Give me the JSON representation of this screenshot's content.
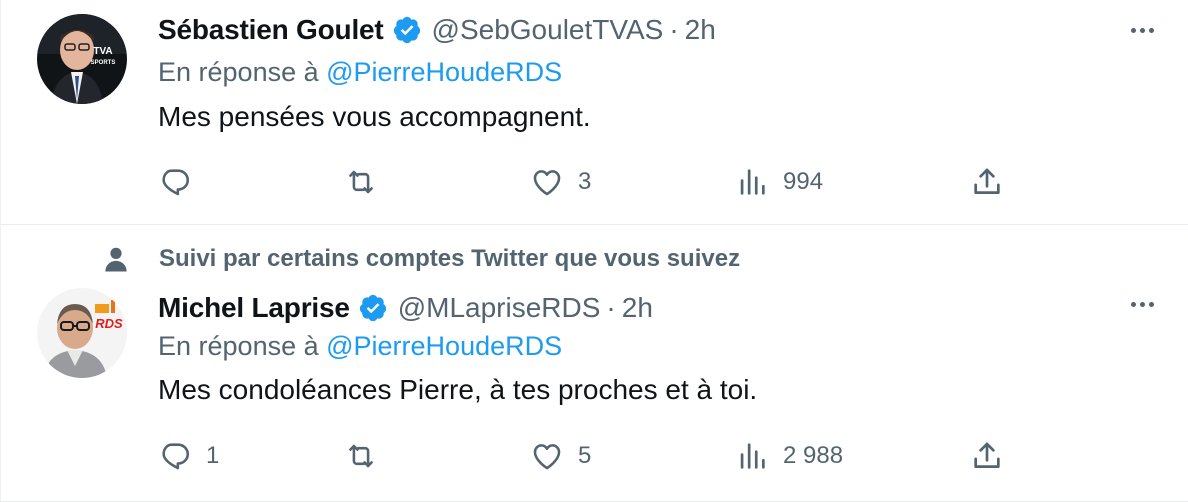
{
  "tweets": [
    {
      "author": {
        "display_name": "Sébastien Goulet",
        "handle": "@SebGouletTVAS",
        "verified": true,
        "avatar": {
          "badge_line1": "TVA",
          "badge_line2": "SPORTS"
        }
      },
      "separator": "·",
      "time": "2h",
      "reply_prefix": "En réponse à ",
      "reply_to": "@PierreHoudeRDS",
      "text": "Mes pensées vous accompagnent.",
      "stats": {
        "replies": "",
        "retweets": "",
        "likes": "3",
        "views": "994"
      }
    },
    {
      "social_context": "Suivi par certains comptes Twitter que vous suivez",
      "author": {
        "display_name": "Michel Laprise",
        "handle": "@MLapriseRDS",
        "verified": true,
        "avatar": {
          "badge": "RDS"
        }
      },
      "separator": "·",
      "time": "2h",
      "reply_prefix": "En réponse à ",
      "reply_to": "@PierreHoudeRDS",
      "text": "Mes condoléances Pierre, à tes proches et à toi.",
      "stats": {
        "replies": "1",
        "retweets": "",
        "likes": "5",
        "views": "2 988"
      }
    }
  ],
  "colors": {
    "text_primary": "#0f1419",
    "text_secondary": "#536471",
    "link": "#1d9bf0",
    "verified": "#1d9bf0",
    "divider": "#e6ecf0"
  },
  "icons": [
    "reply-icon",
    "retweet-icon",
    "like-icon",
    "views-icon",
    "share-icon",
    "verified-icon",
    "more-icon",
    "person-icon"
  ]
}
